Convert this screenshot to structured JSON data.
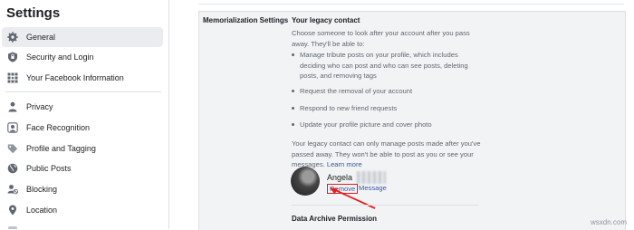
{
  "sidebar": {
    "title": "Settings",
    "items": [
      {
        "label": "General",
        "icon": "gear-icon",
        "active": true
      },
      {
        "label": "Security and Login",
        "icon": "shield-icon"
      },
      {
        "label": "Your Facebook Information",
        "icon": "grid-icon"
      },
      {
        "label": "Privacy",
        "icon": "lock-person-icon"
      },
      {
        "label": "Face Recognition",
        "icon": "face-icon"
      },
      {
        "label": "Profile and Tagging",
        "icon": "tag-icon"
      },
      {
        "label": "Public Posts",
        "icon": "globe-icon"
      },
      {
        "label": "Blocking",
        "icon": "block-user-icon"
      },
      {
        "label": "Location",
        "icon": "location-pin-icon"
      }
    ]
  },
  "main": {
    "section_label": "Memorialization Settings",
    "heading": "Your legacy contact",
    "intro": "Choose someone to look after your account after you pass away. They'll be able to:",
    "bullets": [
      "Manage tribute posts on your profile, which includes deciding who can post and who can see posts, deleting posts, and removing tags",
      "Request the removal of your account",
      "Respond to new friend requests",
      "Update your profile picture and cover photo"
    ],
    "note": "Your legacy contact can only manage posts made after you've passed away. They won't be able to post as you or see your messages.",
    "learn_more": "Learn more",
    "contact": {
      "name": "Angela",
      "remove_label": "Remove",
      "message_label": "Message"
    },
    "next_section_heading": "Data Archive Permission"
  },
  "watermark": "wsxdn.com",
  "colors": {
    "link": "#385898",
    "active_bg": "#eaecef",
    "panel_bg": "#f2f3f5",
    "annotation": "#e41e1e"
  }
}
